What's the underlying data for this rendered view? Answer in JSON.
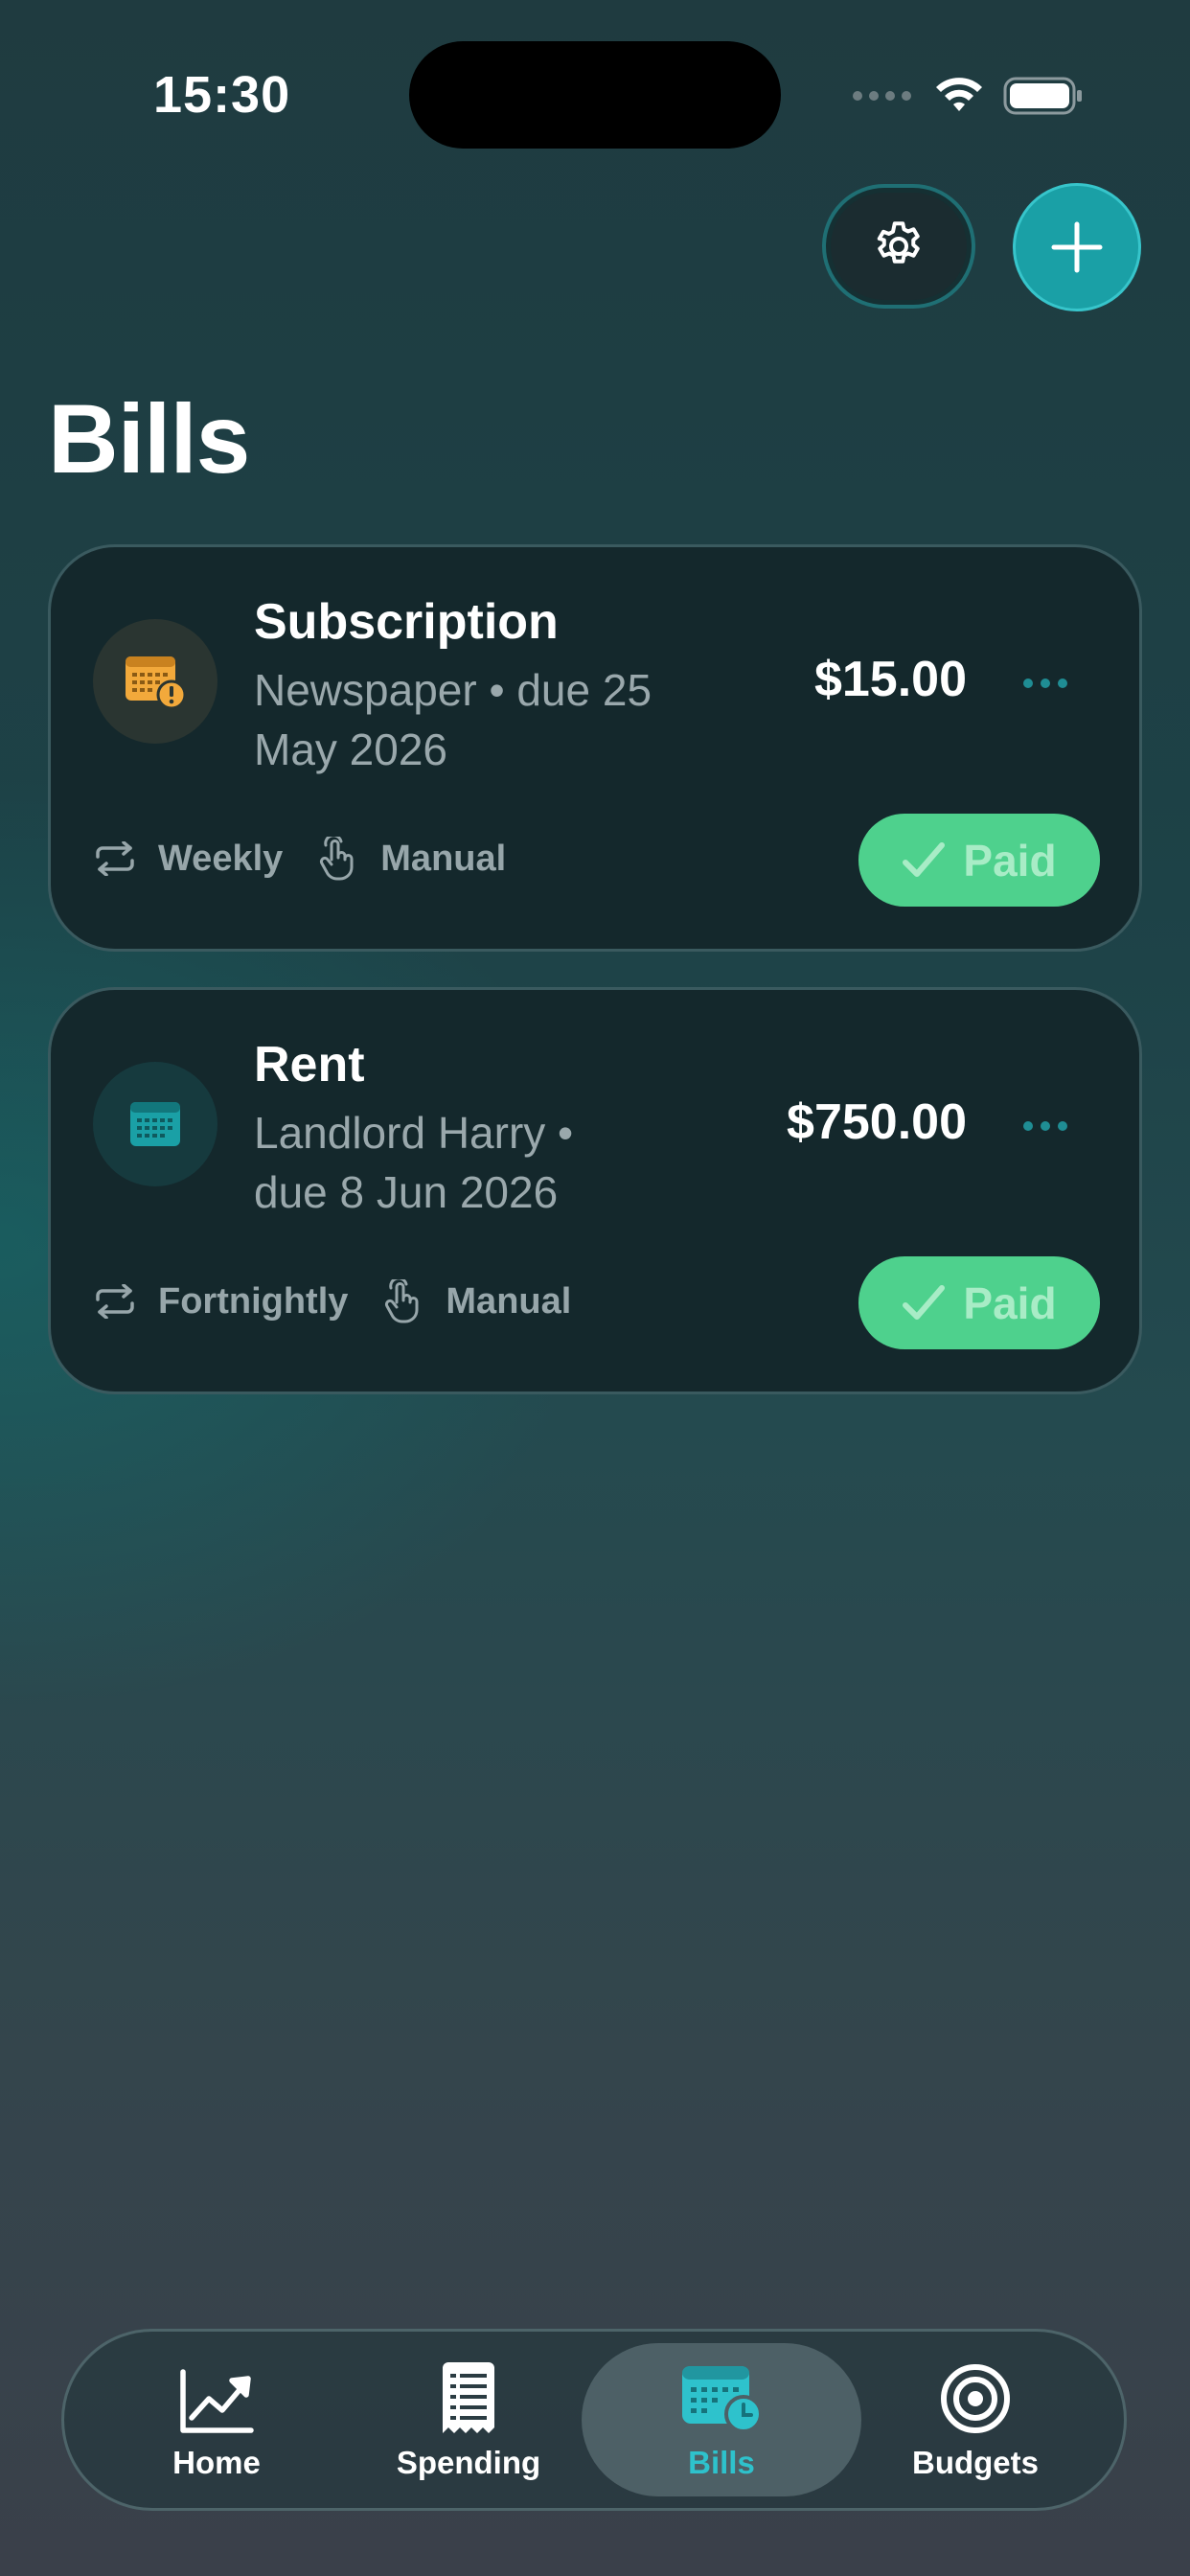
{
  "status_bar": {
    "time": "15:30"
  },
  "header": {
    "settings_icon": "gear-icon",
    "add_icon": "plus-icon",
    "title": "Bills"
  },
  "bills": [
    {
      "icon": "calendar-warning-icon",
      "icon_color": "#f2a93b",
      "title": "Subscription",
      "subtitle": "Newspaper • due 25 May 2026",
      "amount": "$15.00",
      "frequency": "Weekly",
      "method": "Manual",
      "action_label": "Paid"
    },
    {
      "icon": "calendar-icon",
      "icon_color": "#1aa0a6",
      "title": "Rent",
      "subtitle": "Landlord Harry • due 8 Jun 2026",
      "amount": "$750.00",
      "frequency": "Fortnightly",
      "method": "Manual",
      "action_label": "Paid"
    }
  ],
  "tabbar": {
    "active": "Bills",
    "items": [
      {
        "label": "Home",
        "icon": "chart-trend-icon"
      },
      {
        "label": "Spending",
        "icon": "receipt-icon"
      },
      {
        "label": "Bills",
        "icon": "calendar-clock-icon"
      },
      {
        "label": "Budgets",
        "icon": "target-icon"
      }
    ]
  },
  "colors": {
    "accent": "#1aa0a6",
    "paid_button": "#4ed18d",
    "active_tab_label": "#2ec2cc",
    "warning": "#f2a93b"
  }
}
